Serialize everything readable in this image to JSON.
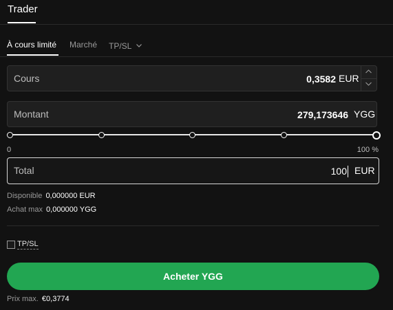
{
  "header": {
    "tab_label": "Trader"
  },
  "order_tabs": [
    {
      "label": "À cours limité",
      "active": true
    },
    {
      "label": "Marché",
      "active": false
    },
    {
      "label": "TP/SL",
      "active": false
    }
  ],
  "price": {
    "label": "Cours",
    "value": "0,3582",
    "unit": "EUR"
  },
  "amount": {
    "label": "Montant",
    "value": "279,173646",
    "unit": "YGG"
  },
  "slider": {
    "min_label": "0",
    "max_label": "100 %",
    "value_percent": 100
  },
  "total": {
    "label": "Total",
    "value": "100",
    "unit": "EUR"
  },
  "balances": {
    "available_label": "Disponible",
    "available_value": "0,000000 EUR",
    "max_buy_label": "Achat max",
    "max_buy_value": "0,000000 YGG"
  },
  "tpsl": {
    "label": "TP/SL",
    "checked": false
  },
  "buy_button": {
    "label": "Acheter YGG",
    "color": "#22a652"
  },
  "max_price": {
    "label": "Prix max.",
    "value": "€0,3774"
  }
}
